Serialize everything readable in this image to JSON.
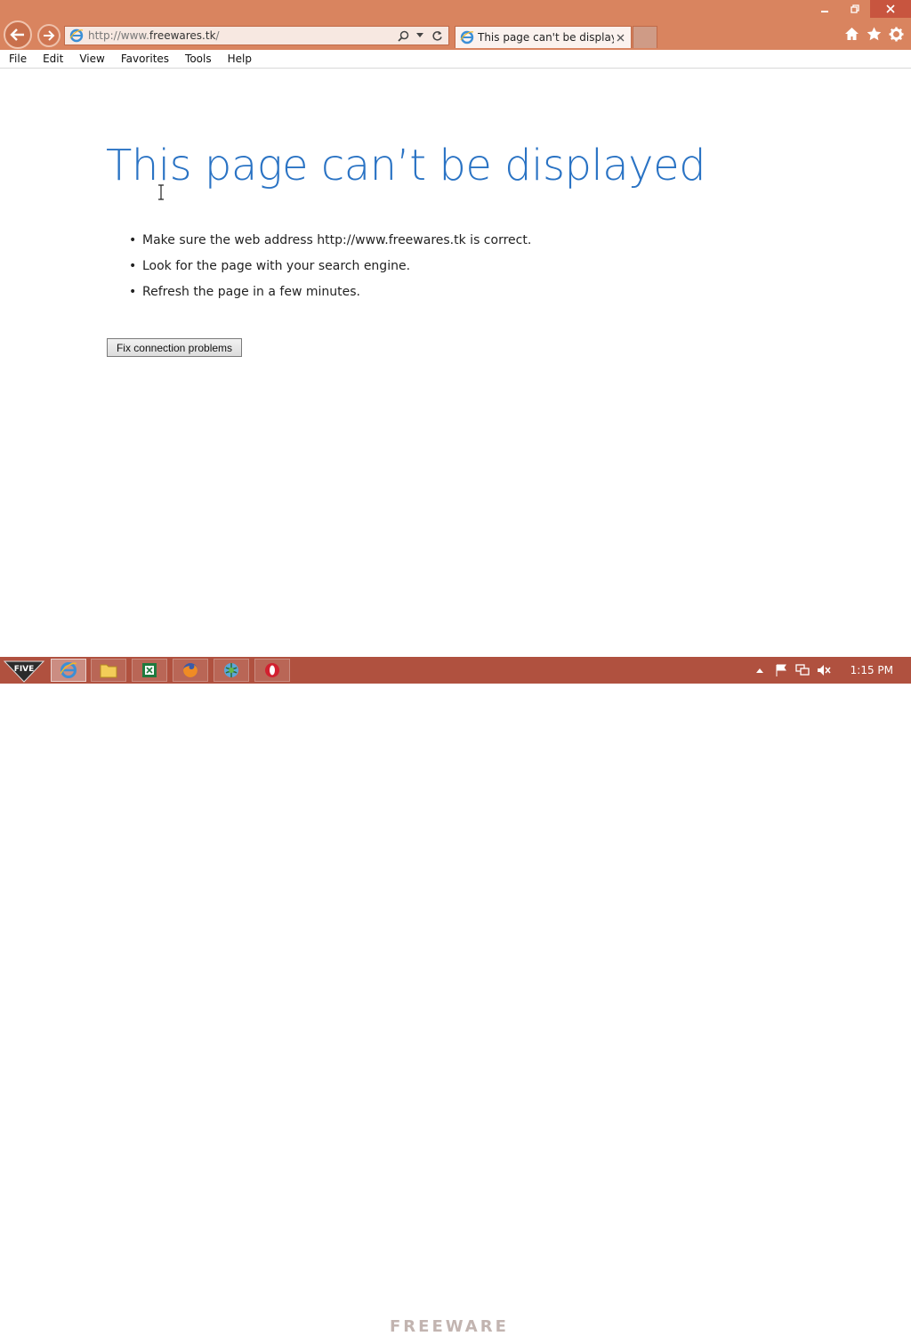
{
  "window": {
    "minimize_icon": "minimize-icon",
    "restore_icon": "restore-icon",
    "close_icon": "close-icon"
  },
  "toolbar": {
    "back_icon": "back-arrow-icon",
    "forward_icon": "forward-arrow-icon",
    "address": {
      "prefix": "http://www.",
      "domain": "freewares.tk",
      "suffix": "/"
    },
    "search_icon": "search-icon",
    "dropdown_icon": "chevron-down-icon",
    "refresh_icon": "refresh-icon"
  },
  "tab": {
    "label": "This page can't be displayed",
    "close_icon": "close-icon"
  },
  "right_icons": [
    "home-icon",
    "star-icon",
    "gear-icon"
  ],
  "menu": [
    "File",
    "Edit",
    "View",
    "Favorites",
    "Tools",
    "Help"
  ],
  "content": {
    "title": "This page can’t be displayed",
    "suggestions": [
      "Make sure the web address http://www.freewares.tk is correct.",
      "Look for the page with your search engine.",
      "Refresh the page in a few minutes."
    ],
    "fix_button": "Fix connection problems"
  },
  "taskbar": {
    "start_label": "FIVE",
    "apps": [
      "internet-explorer-icon",
      "file-explorer-icon",
      "excel-icon",
      "firefox-icon",
      "network-icon",
      "opera-icon"
    ],
    "watermark": "FREEWARE",
    "tray_icons": [
      "up-arrow-icon",
      "flag-icon",
      "network-icon",
      "volume-muted-icon"
    ],
    "clock": "1:15 PM"
  },
  "colors": {
    "chrome": "#d9845f",
    "title_blue": "#2a73c4",
    "taskbar": "#b0513f"
  }
}
